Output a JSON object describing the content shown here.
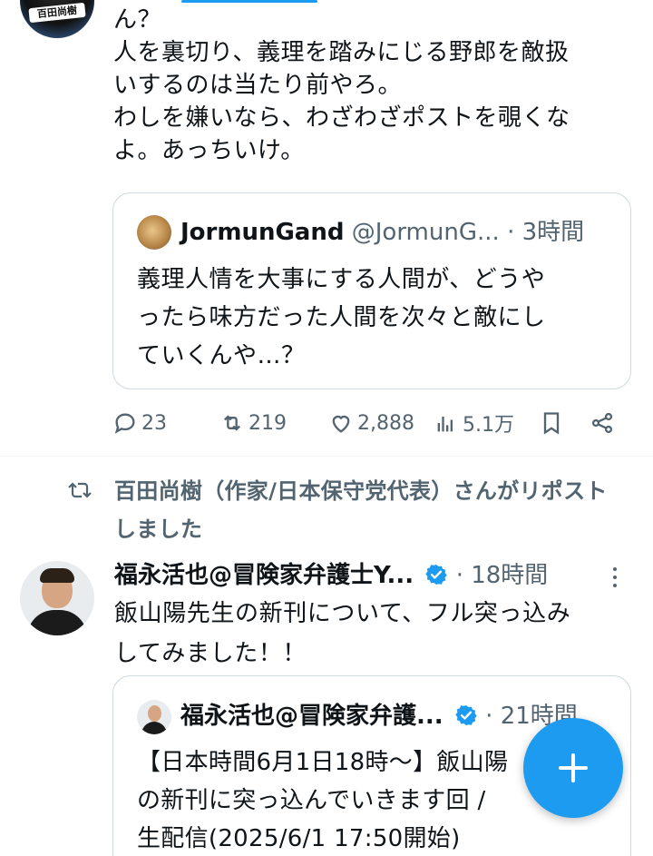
{
  "tweet1": {
    "avatar_sign": "百田尚樹",
    "body_lines": [
      "ん？",
      "人を裏切り、義理を踏みにじる野郎を敵扱",
      "いするのは当たり前やろ。",
      "わしを嫌いなら、わざわざポストを覗くな",
      "よ。あっちいけ。"
    ],
    "quote": {
      "name": "JormunGand",
      "handle": "@JormunG...",
      "time": "· 3時間",
      "text_lines": [
        "義理人情を大事にする人間が、どうや",
        "ったら味方だった人間を次々と敵にし",
        "ていくんや…？"
      ]
    },
    "actions": {
      "replies": "23",
      "reposts": "219",
      "likes": "2,888",
      "views": "5.1万"
    }
  },
  "repost_notice": {
    "lines": [
      "百田尚樹（作家/日本保守党代表）さんがリポスト",
      "しました"
    ]
  },
  "tweet2": {
    "name": "福永活也@冒険家弁護士Y...",
    "time": "· 18時間",
    "body_lines": [
      "飯山陽先生の新刊について、フル突っ込み",
      "してみました！！"
    ],
    "quote": {
      "name": "福永活也@冒険家弁護...",
      "time": "· 21時間",
      "text_lines": [
        "【日本時間6月1日18時〜】飯山陽",
        "の新刊に突っ込んでいきます回 /",
        "生配信(2025/6/1 17:50開始)"
      ]
    }
  },
  "colors": {
    "accent": "#1d9bf0",
    "secondary_text": "#536471",
    "border": "#cfd9de"
  },
  "icons": [
    "reply-icon",
    "repost-icon",
    "like-icon",
    "views-icon",
    "bookmark-icon",
    "share-icon",
    "verified-icon",
    "more-icon",
    "compose-plus-icon"
  ]
}
